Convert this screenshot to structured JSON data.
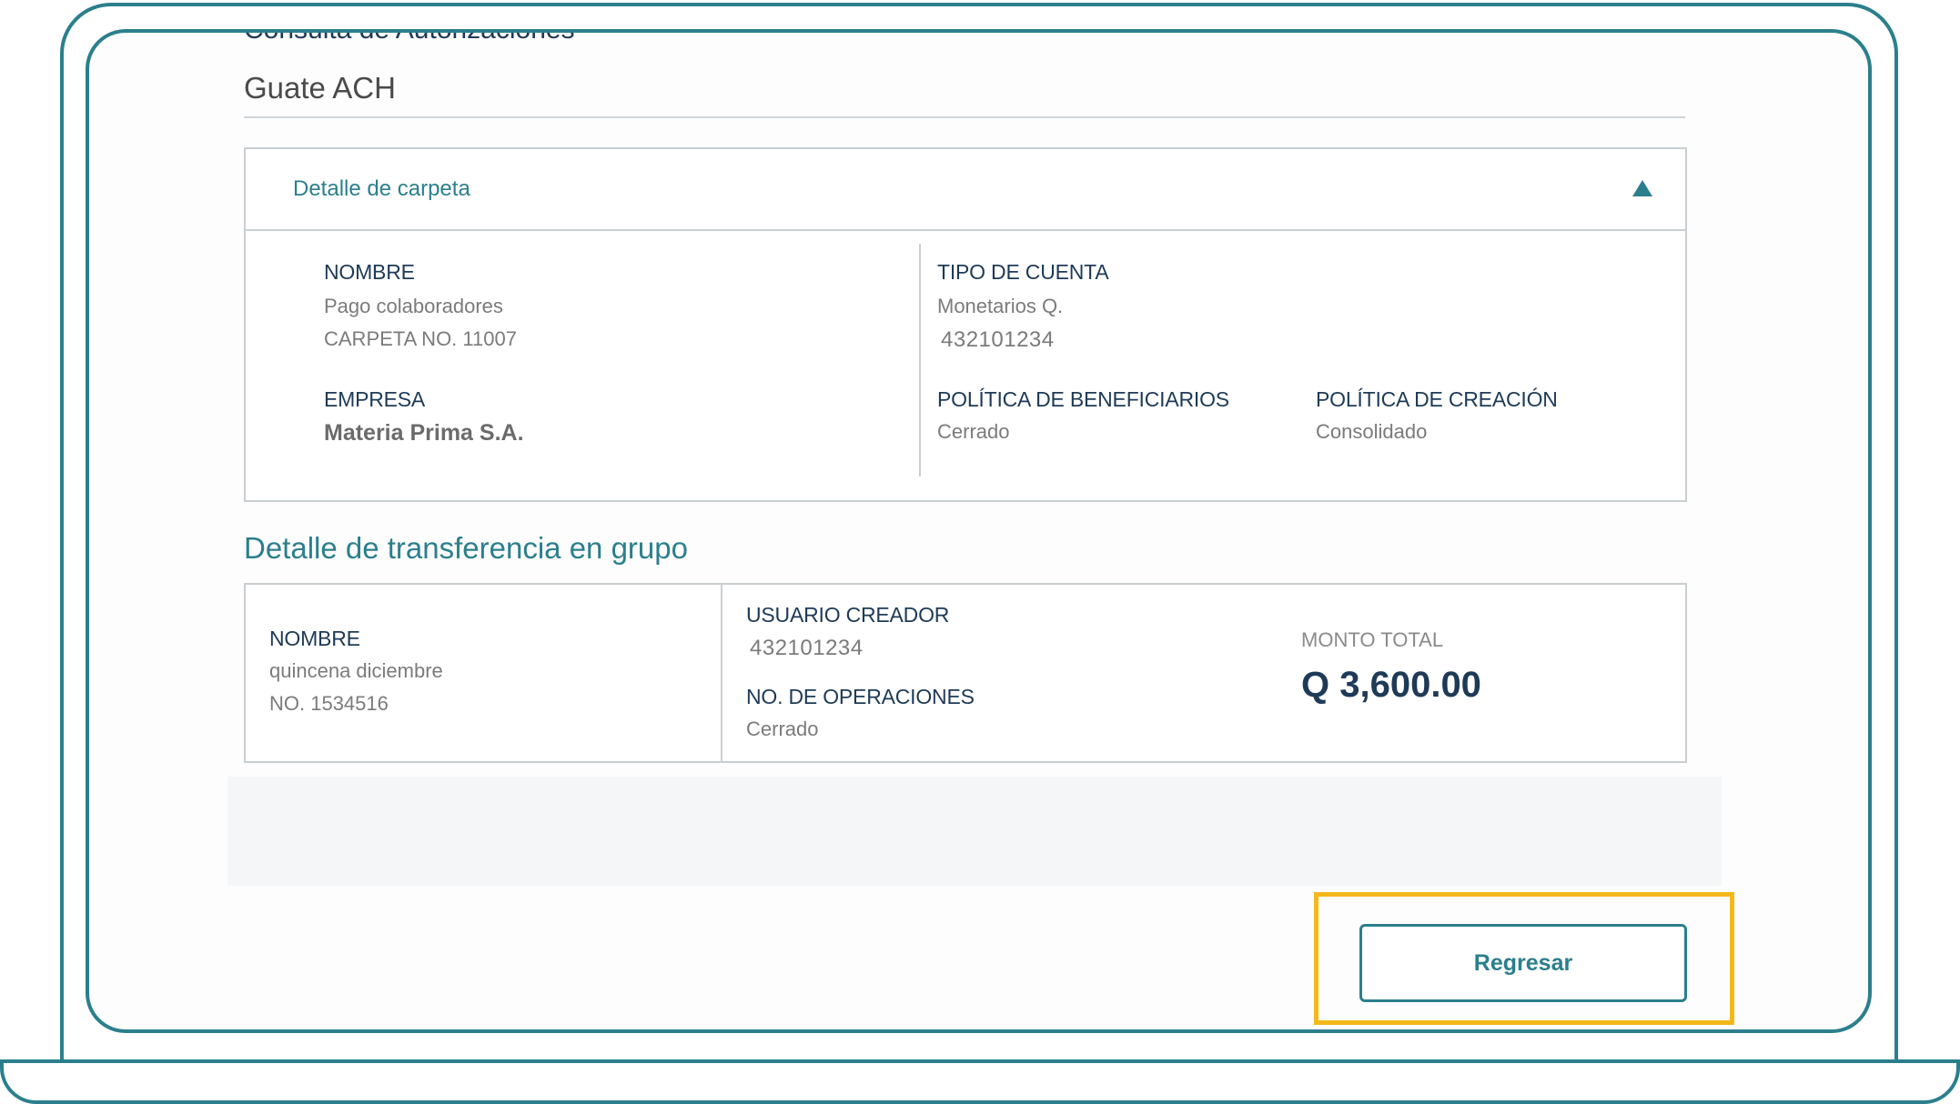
{
  "page": {
    "cut_title": "Consulta de Autorizaciones",
    "subtitle": "Guate ACH"
  },
  "folder_panel": {
    "header_label": "Detalle de carpeta",
    "nombre_label": "NOMBRE",
    "nombre_value": "Pago colaboradores",
    "carpeta_no": "CARPETA NO. 11007",
    "empresa_label": "EMPRESA",
    "empresa_value": "Materia Prima S.A.",
    "tipo_cuenta_label": "TIPO DE CUENTA",
    "tipo_cuenta_value": "Monetarios Q.",
    "cuenta_numero": "432101234",
    "politica_beneficiarios_label": "POLÍTICA DE BENEFICIARIOS",
    "politica_beneficiarios_value": "Cerrado",
    "politica_creacion_label": "POLÍTICA DE CREACIÓN",
    "politica_creacion_value": "Consolidado"
  },
  "transfer_section": {
    "title": "Detalle de transferencia en grupo",
    "nombre_label": "NOMBRE",
    "nombre_value": "quincena diciembre",
    "numero": "NO. 1534516",
    "usuario_creador_label": "USUARIO CREADOR",
    "usuario_creador_value": "432101234",
    "operaciones_label": "NO. DE OPERACIONES",
    "operaciones_value": "Cerrado",
    "monto_total_label": "MONTO TOTAL",
    "monto_total_value": "Q 3,600.00"
  },
  "actions": {
    "regresar_label": "Regresar"
  },
  "colors": {
    "accent": "#2b7f8c",
    "navy": "#1e3a57",
    "highlight": "#f5b81a"
  }
}
